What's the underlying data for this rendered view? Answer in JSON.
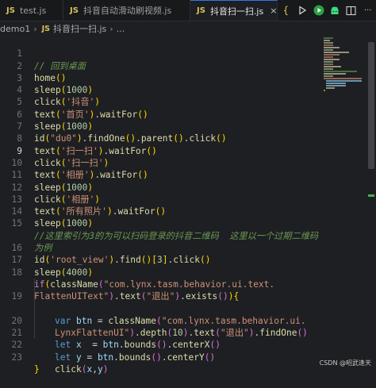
{
  "tabs": [
    {
      "icon": "JS",
      "label": "test.js"
    },
    {
      "icon": "JS",
      "label": "抖音自动滑动刷视频.js"
    },
    {
      "icon": "JS",
      "label": "抖音扫一扫.js",
      "close": "×"
    }
  ],
  "tab_actions": {
    "braces": "{",
    "overflow": "···"
  },
  "breadcrumb": {
    "folder": "demo1",
    "sep": "›",
    "icon": "JS",
    "file": "抖音扫一扫.js",
    "sep2": "›",
    "more": "..."
  },
  "editor": {
    "lines": [
      {
        "n": "1"
      },
      {
        "n": "2"
      },
      {
        "n": "3"
      },
      {
        "n": "4"
      },
      {
        "n": "5"
      },
      {
        "n": "6"
      },
      {
        "n": "7"
      },
      {
        "n": "8"
      },
      {
        "n": "9"
      },
      {
        "n": "10"
      },
      {
        "n": "11"
      },
      {
        "n": "12"
      },
      {
        "n": "13"
      },
      {
        "n": "14"
      },
      {
        "n": "15"
      },
      {
        "n": ""
      },
      {
        "n": "16"
      },
      {
        "n": "17"
      },
      {
        "n": "18"
      },
      {
        "n": ""
      },
      {
        "n": "19"
      },
      {
        "n": ""
      },
      {
        "n": "20"
      },
      {
        "n": "21"
      },
      {
        "n": "22"
      },
      {
        "n": "23"
      }
    ],
    "current_line": "9",
    "t": {
      "c1": "// 回到桌面",
      "home": "home",
      "e": "()",
      "sleep": "sleep",
      "lp": "(",
      "rp": ")",
      "n1000": "1000",
      "n4000": "4000",
      "click": "click",
      "s_douyin": "'抖音'",
      "text": "text",
      "s_home": "'首页'",
      "dot": ".",
      "waitFor": "waitFor",
      "id": "id",
      "s_du0": "\"du0\"",
      "findOne": "findOne",
      "parent": "parent",
      "s_scan": "'扫一扫'",
      "s_album": "'相册'",
      "s_allphotos": "'所有照片'",
      "c15a": "//这里索引为3的为可以扫码登录的抖音二维码  这里以一个过期二维码",
      "c15b": "为例",
      "s_rootview": "'root_view'",
      "find": "find",
      "lb": "[",
      "rb": "]",
      "n3": "3",
      "kw_if": "if",
      "className": "className",
      "s_lynx1a": "\"com.lynx.tasm.behavior.ui.text.",
      "s_lynx1b": "FlattenUIText\"",
      "s_exit": "\"退出\"",
      "exists": "exists",
      "brace_open": "{",
      "kw_var": "var",
      "btn": "btn",
      "eq": " = ",
      "s_lynx2a": "\"com.lynx.tasm.behavior.ui.",
      "s_lynx2b": "LynxFlattenUI\"",
      "depth": "depth",
      "n10": "10",
      "kw_let": "let",
      "x": "x",
      "y": "y",
      "eq2": "  = ",
      "bounds": "bounds",
      "centerX": "centerX",
      "centerY": "centerY",
      "comma": ",",
      "brace_close": "}"
    }
  },
  "watermark": "CSDN @昭武逢天",
  "colors": {
    "background": "#1e1f22",
    "accent": "#3574f0",
    "js_icon": "#d8c05a"
  }
}
